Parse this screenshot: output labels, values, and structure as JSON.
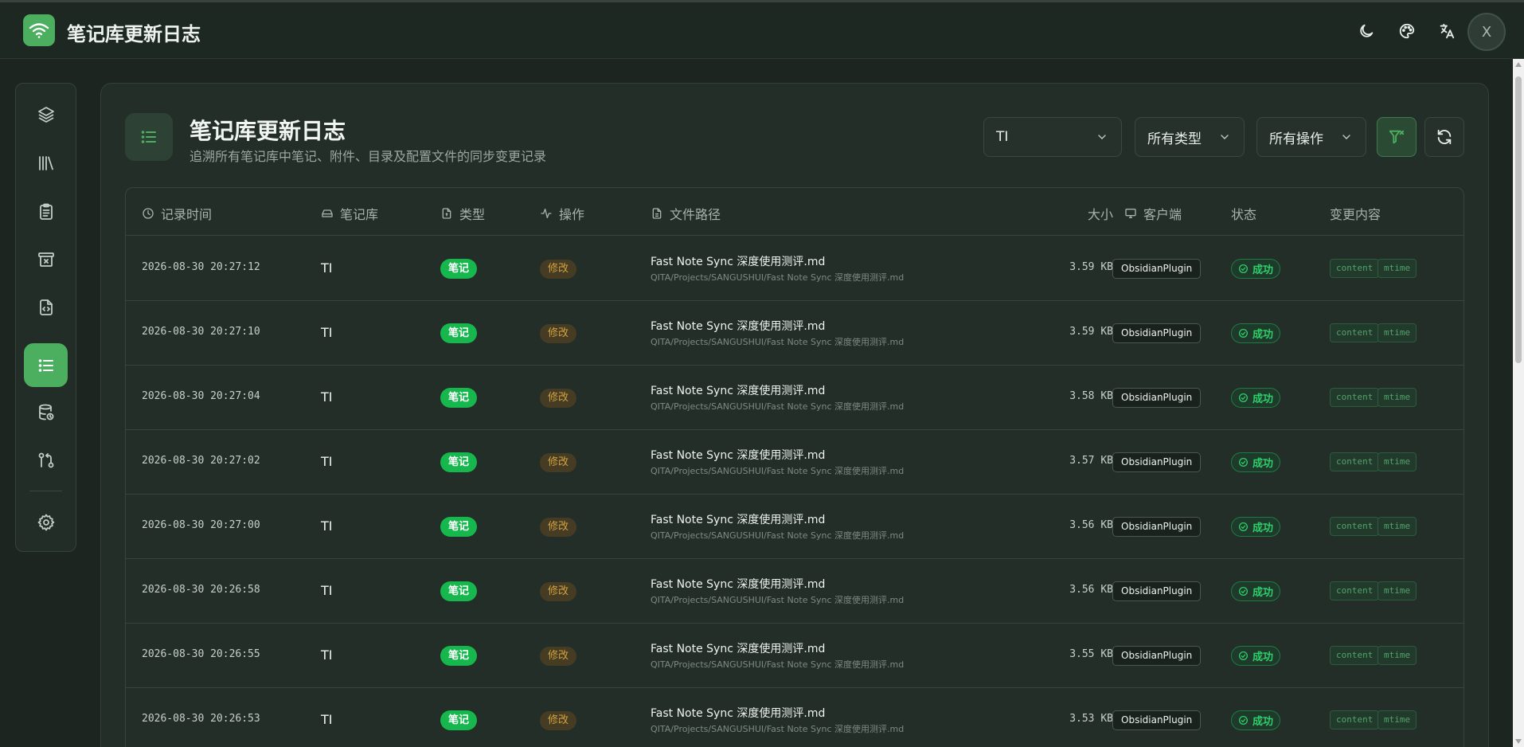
{
  "app": {
    "title": "笔记库更新日志",
    "avatar_initial": "X",
    "accent_color": "#4caf5f"
  },
  "header_icons": [
    "moon-icon",
    "palette-icon",
    "translate-icon"
  ],
  "sidebar": {
    "items": [
      {
        "name": "layers-icon",
        "active": false
      },
      {
        "name": "library-icon",
        "active": false
      },
      {
        "name": "clipboard-icon",
        "active": false
      },
      {
        "name": "archive-icon",
        "active": false
      },
      {
        "name": "code-file-icon",
        "active": false
      },
      {
        "name": "list-icon",
        "active": true
      },
      {
        "name": "database-icon",
        "active": false
      },
      {
        "name": "git-compare-icon",
        "active": false
      },
      {
        "name": "gear-icon",
        "active": false
      }
    ]
  },
  "page": {
    "title": "笔记库更新日志",
    "subtitle": "追溯所有笔记库中笔记、附件、目录及配置文件的同步变更记录"
  },
  "filters": {
    "vault": "TI",
    "type": "所有类型",
    "operation": "所有操作"
  },
  "table": {
    "headers": {
      "time": "记录时间",
      "vault": "笔记库",
      "type": "类型",
      "op": "操作",
      "path": "文件路径",
      "size": "大小",
      "client": "客户端",
      "status": "状态",
      "changes": "变更内容"
    },
    "rows": [
      {
        "time": "2026-08-30 20:27:12",
        "vault": "TI",
        "type": "笔记",
        "op": "修改",
        "file": "Fast Note Sync 深度使用测评.md",
        "path": "QITA/Projects/SANGUSHUI/Fast Note Sync 深度使用测评.md",
        "size": "3.59 KB",
        "client": "ObsidianPlugin",
        "status": "成功",
        "tag1": "content",
        "tag2": "mtime"
      },
      {
        "time": "2026-08-30 20:27:10",
        "vault": "TI",
        "type": "笔记",
        "op": "修改",
        "file": "Fast Note Sync 深度使用测评.md",
        "path": "QITA/Projects/SANGUSHUI/Fast Note Sync 深度使用测评.md",
        "size": "3.59 KB",
        "client": "ObsidianPlugin",
        "status": "成功",
        "tag1": "content",
        "tag2": "mtime"
      },
      {
        "time": "2026-08-30 20:27:04",
        "vault": "TI",
        "type": "笔记",
        "op": "修改",
        "file": "Fast Note Sync 深度使用测评.md",
        "path": "QITA/Projects/SANGUSHUI/Fast Note Sync 深度使用测评.md",
        "size": "3.58 KB",
        "client": "ObsidianPlugin",
        "status": "成功",
        "tag1": "content",
        "tag2": "mtime"
      },
      {
        "time": "2026-08-30 20:27:02",
        "vault": "TI",
        "type": "笔记",
        "op": "修改",
        "file": "Fast Note Sync 深度使用测评.md",
        "path": "QITA/Projects/SANGUSHUI/Fast Note Sync 深度使用测评.md",
        "size": "3.57 KB",
        "client": "ObsidianPlugin",
        "status": "成功",
        "tag1": "content",
        "tag2": "mtime"
      },
      {
        "time": "2026-08-30 20:27:00",
        "vault": "TI",
        "type": "笔记",
        "op": "修改",
        "file": "Fast Note Sync 深度使用测评.md",
        "path": "QITA/Projects/SANGUSHUI/Fast Note Sync 深度使用测评.md",
        "size": "3.56 KB",
        "client": "ObsidianPlugin",
        "status": "成功",
        "tag1": "content",
        "tag2": "mtime"
      },
      {
        "time": "2026-08-30 20:26:58",
        "vault": "TI",
        "type": "笔记",
        "op": "修改",
        "file": "Fast Note Sync 深度使用测评.md",
        "path": "QITA/Projects/SANGUSHUI/Fast Note Sync 深度使用测评.md",
        "size": "3.56 KB",
        "client": "ObsidianPlugin",
        "status": "成功",
        "tag1": "content",
        "tag2": "mtime"
      },
      {
        "time": "2026-08-30 20:26:55",
        "vault": "TI",
        "type": "笔记",
        "op": "修改",
        "file": "Fast Note Sync 深度使用测评.md",
        "path": "QITA/Projects/SANGUSHUI/Fast Note Sync 深度使用测评.md",
        "size": "3.55 KB",
        "client": "ObsidianPlugin",
        "status": "成功",
        "tag1": "content",
        "tag2": "mtime"
      },
      {
        "time": "2026-08-30 20:26:53",
        "vault": "TI",
        "type": "笔记",
        "op": "修改",
        "file": "Fast Note Sync 深度使用测评.md",
        "path": "QITA/Projects/SANGUSHUI/Fast Note Sync 深度使用测评.md",
        "size": "3.53 KB",
        "client": "ObsidianPlugin",
        "status": "成功",
        "tag1": "content",
        "tag2": "mtime"
      }
    ]
  }
}
